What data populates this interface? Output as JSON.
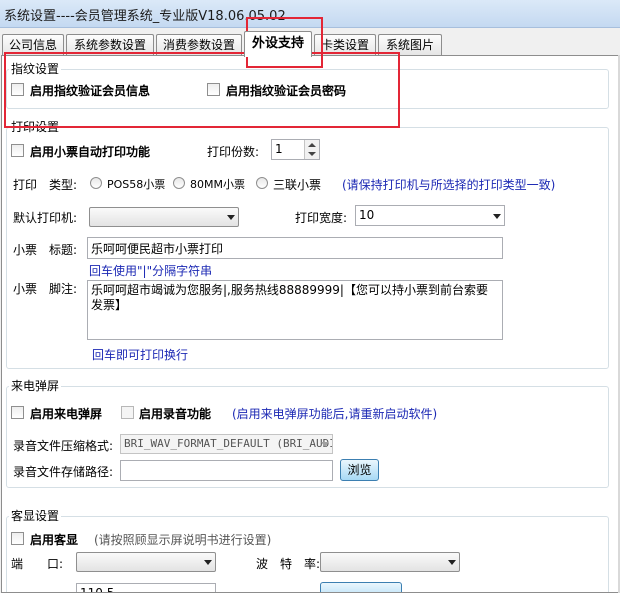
{
  "window": {
    "title": "系统设置----会员管理系统_专业版V18.06.05.02"
  },
  "tabs": [
    "公司信息",
    "系统参数设置",
    "消费参数设置",
    "外设支持",
    "卡类设置",
    "系统图片"
  ],
  "fingerprint": {
    "title": "指纹设置",
    "verify_info_label": "启用指纹验证会员信息",
    "verify_password_label": "启用指纹验证会员密码"
  },
  "print": {
    "title": "打印设置",
    "auto_print_label": "启用小票自动打印功能",
    "copies_label": "打印份数:",
    "copies_value": "1",
    "type_label": "打印　类型:",
    "type_options": [
      "POS58小票",
      "80MM小票",
      "三联小票"
    ],
    "type_hint": "(请保持打印机与所选择的打印类型一致)",
    "default_printer_label": "默认打印机:",
    "default_printer_value": "",
    "width_label": "打印宽度:",
    "width_value": "10",
    "ticket_title_label": "小票　标题:",
    "ticket_title_value": "乐呵呵便民超市小票打印",
    "title_hint": "回车使用\"|\"分隔字符串",
    "ticket_footer_label": "小票　脚注:",
    "ticket_footer_value": "乐呵呵超市竭诚为您服务|,服务热线88889999|【您可以持小票到前台索要发票】",
    "footer_hint": "回车即可打印换行"
  },
  "caller": {
    "title": "来电弹屏",
    "enable_popup_label": "启用来电弹屏",
    "enable_record_label": "启用录音功能",
    "hint": "(启用来电弹屏功能后,请重新启动软件)",
    "compress_label": "录音文件压缩格式:",
    "compress_value": "BRI_WAV_FORMAT_DEFAULT (BRI_AUDI",
    "path_label": "录音文件存储路径:",
    "path_value": "",
    "browse_label": "浏览"
  },
  "customer_display": {
    "title": "客显设置",
    "enable_label": "启用客显",
    "hint": "(请按照顾显示屏说明书进行设置)",
    "port_label": "端　　口:",
    "baud_label": "波　特　率:",
    "test_value": "110.5"
  },
  "colors": {
    "hint_blue": "#1c29b4",
    "highlight_red": "#e32636",
    "titlebar": "#c4d9f1"
  }
}
